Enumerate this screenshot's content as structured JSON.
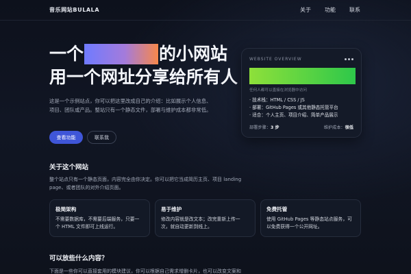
{
  "nav": {
    "brand": "音乐网站BULALA",
    "links": [
      "关于",
      "功能",
      "联系"
    ]
  },
  "hero": {
    "title_line1_before": "一个",
    "title_line1_after": "的小网站",
    "title_line2": "用一个网址分享给所有人",
    "description": "这是一个示例站点，你可以把这里改成自己的介绍：比如展示个人信息、项目、团队或产品。整站只有一个静态文件，部署与维护成本都非常低。",
    "primary_button": "查看功能",
    "secondary_button": "联系我"
  },
  "overview_card": {
    "label": "WEBSITE OVERVIEW",
    "progress": 1.0,
    "progress_colors": [
      "#8ee03a",
      "#2ec84a"
    ],
    "caption": "任何人都可以直接在浏览器中访问",
    "items": [
      "· 技术栈：HTML / CSS / JS",
      "· 部署：GitHub Pages 或其他静态托管平台",
      "· 适合：个人主页、项目介绍、简单产品展示"
    ],
    "footer_left_label": "部署步骤：",
    "footer_left_value": "3 步",
    "footer_right_label": "维护成本：",
    "footer_right_value": "很低"
  },
  "about": {
    "title": "关于这个网站",
    "description": "整个站点只有一个静态页面，内容完全由你决定。你可以把它当成简历主页、项目 landing page、或者团队的对外介绍页面。"
  },
  "features": [
    {
      "title": "极简架构",
      "text": "不需要数据库，不需要后端服务，只要一个 HTML 文件即可上线运行。"
    },
    {
      "title": "易于维护",
      "text": "修改内容就是改文本；改完重新上传一次，就自动更新到线上。"
    },
    {
      "title": "免费托管",
      "text": "使用 GitHub Pages 等静态站点服务，可以免费获得一个公开网址。"
    }
  ],
  "content_section": {
    "title": "可以放些什么内容？",
    "description": "下面是一些你可以直接套用的模块建议，你可以根据自己需求增删卡片，也可以改变文案和"
  },
  "colors": {
    "accent": "#3f56d8",
    "highlight_gradient": [
      "#6f7bff",
      "#a47bdb",
      "#f7884b"
    ],
    "background": "#0d111c"
  }
}
